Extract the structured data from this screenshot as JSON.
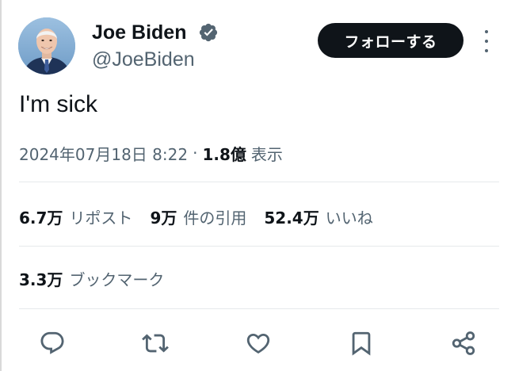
{
  "author": {
    "display_name": "Joe Biden",
    "handle": "@JoeBiden",
    "verified": true,
    "badge_color": "#536471"
  },
  "follow_button": {
    "label": "フォローする"
  },
  "tweet": {
    "text": "I'm sick",
    "timestamp": "2024年07月18日 8:22",
    "separator": "·",
    "views_count": "1.8億",
    "views_label": "表示"
  },
  "stats": {
    "reposts": {
      "count": "6.7万",
      "label": "リポスト"
    },
    "quotes": {
      "count": "9万",
      "label": "件の引用"
    },
    "likes": {
      "count": "52.4万",
      "label": "いいね"
    },
    "bookmarks": {
      "count": "3.3万",
      "label": "ブックマーク"
    }
  },
  "actions": [
    {
      "icon": "reply-icon"
    },
    {
      "icon": "retweet-icon"
    },
    {
      "icon": "like-icon"
    },
    {
      "icon": "bookmark-icon"
    },
    {
      "icon": "share-icon"
    }
  ],
  "colors": {
    "text_primary": "#0f1419",
    "text_secondary": "#536471",
    "follow_button_bg": "#0f1419",
    "divider": "#e6e9eb"
  }
}
